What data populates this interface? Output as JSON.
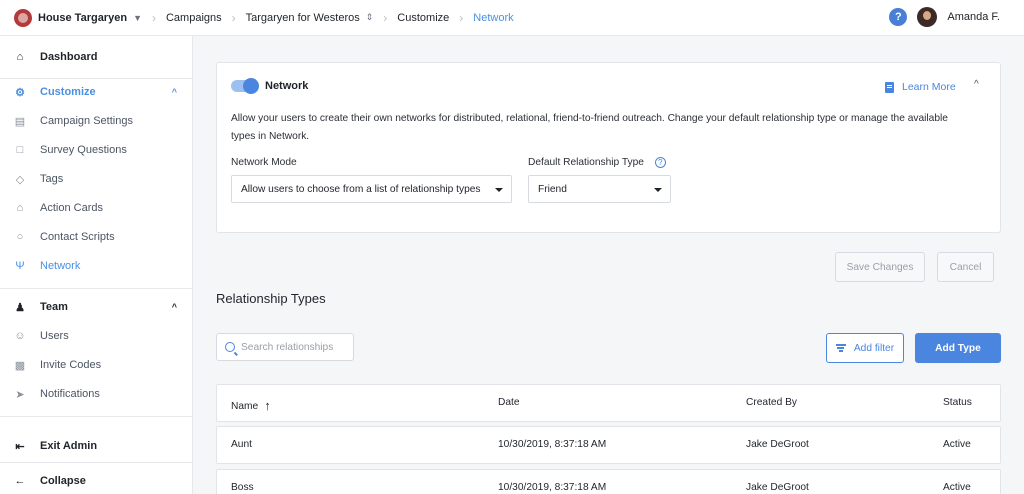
{
  "topbar": {
    "org_name": "House Targaryen",
    "campaigns": "Campaigns",
    "campaign_name": "Targaryen for Westeros",
    "customize": "Customize",
    "current": "Network",
    "help_label": "?",
    "user_name": "Amanda F."
  },
  "sidebar": {
    "dashboard": "Dashboard",
    "customize": "Customize",
    "customize_items": [
      "Campaign Settings",
      "Survey Questions",
      "Tags",
      "Action Cards",
      "Contact Scripts",
      "Network"
    ],
    "team": "Team",
    "team_items": [
      "Users",
      "Invite Codes",
      "Notifications"
    ],
    "exit_admin": "Exit Admin",
    "collapse": "Collapse"
  },
  "network_card": {
    "enabled": true,
    "title": "Network",
    "learn_more": "Learn More",
    "description": "Allow your users to create their own networks for distributed, relational, friend-to-friend outreach. Change your default relationship type or manage the available types in Network.",
    "network_mode_label": "Network Mode",
    "network_mode_value": "Allow users to choose from a list of relationship types",
    "default_type_label": "Default Relationship Type",
    "default_type_value": "Friend"
  },
  "actions": {
    "save": "Save Changes",
    "cancel": "Cancel"
  },
  "relationship_types": {
    "title": "Relationship Types",
    "search_placeholder": "Search relationships",
    "add_filter": "Add filter",
    "add_type": "Add Type",
    "columns": [
      "Name",
      "Date",
      "Created By",
      "Status"
    ],
    "rows": [
      [
        "Aunt",
        "10/30/2019, 8:37:18 AM",
        "Jake DeGroot",
        "Active"
      ],
      [
        "Boss",
        "10/30/2019, 8:37:18 AM",
        "Jake DeGroot",
        "Active"
      ]
    ]
  },
  "colors": {
    "accent": "#4a86e0",
    "link": "#4a90e2",
    "background": "#f5f6f8"
  }
}
